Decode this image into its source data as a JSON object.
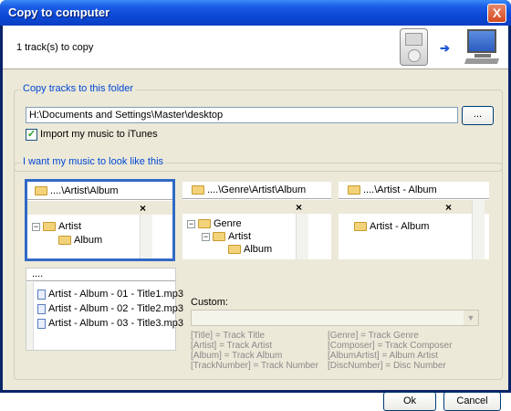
{
  "window": {
    "title": "Copy to computer",
    "close_glyph": "X"
  },
  "header": {
    "status": "1 track(s) to copy",
    "icons": [
      "ipod-icon",
      "arrow-right-icon",
      "computer-icon"
    ],
    "arrow_glyph": "➔"
  },
  "copy_folder": {
    "group_label": "Copy tracks to this folder",
    "path_value": "H:\\Documents and Settings\\Master\\desktop",
    "browse_label": "...",
    "import_checked": true,
    "import_label": "Import my music to iTunes",
    "check_glyph": "✓"
  },
  "look": {
    "group_label": "I want my music to look like this",
    "options": [
      {
        "path": "....\\Artist\\Album",
        "tree": [
          "Artist",
          "Album"
        ],
        "selected": true
      },
      {
        "path": "....\\Genre\\Artist\\Album",
        "tree": [
          "Genre",
          "Artist",
          "Album"
        ],
        "selected": false
      },
      {
        "path": "....\\Artist - Album",
        "tree": [
          "Artist - Album"
        ],
        "selected": false
      }
    ],
    "close_glyph": "×",
    "minus_glyph": "−",
    "flat": {
      "path": "....",
      "files": [
        "Artist - Album - 01 - Title1.mp3",
        "Artist - Album - 02 - Title2.mp3",
        "Artist - Album - 03 - Title3.mp3"
      ]
    },
    "custom": {
      "label": "Custom:",
      "value": "",
      "dropdown_glyph": "▼",
      "legend_left": [
        "[Title] = Track Title",
        "[Artist] = Track Artist",
        "[Album] = Track Album",
        "[TrackNumber] = Track Number"
      ],
      "legend_right": [
        "[Genre] = Track Genre",
        "[Composer] = Track Composer",
        "[AlbumArtist] = Album Artist",
        "[DiscNumber] = Disc Number"
      ]
    }
  },
  "buttons": {
    "ok": "Ok",
    "cancel": "Cancel"
  }
}
